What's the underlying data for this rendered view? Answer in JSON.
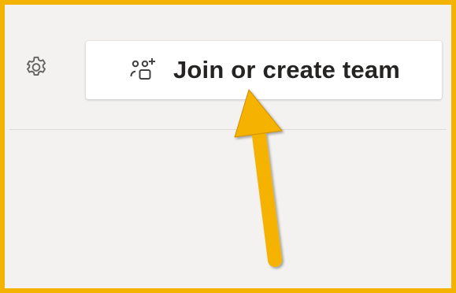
{
  "toolbar": {
    "settings_icon": "gear-icon",
    "join_button": {
      "icon": "people-add-icon",
      "label": "Join or create team"
    }
  },
  "annotation": {
    "type": "arrow",
    "color": "#f5b301",
    "points_to": "Join or create team"
  },
  "colors": {
    "frame_border": "#f5b301",
    "background": "#f3f2f1",
    "button_background": "#ffffff",
    "text": "#252423"
  }
}
